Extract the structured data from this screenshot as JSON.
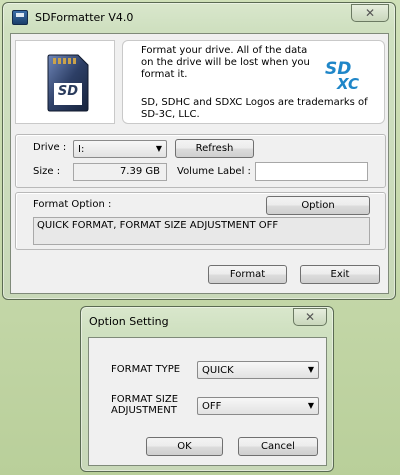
{
  "main_window": {
    "title": "SDFormatter V4.0",
    "close_glyph": "✕",
    "notice_line1": "Format your drive. All of the data",
    "notice_line2": "on the drive will be lost when you",
    "notice_line3": "format it.",
    "trademark_line1": "SD, SDHC and SDXC Logos are trademarks of",
    "trademark_line2": "SD-3C, LLC.",
    "logo_sd": "SD",
    "logo_xc": "XC",
    "card_label": "SD",
    "drive_label": "Drive :",
    "drive_value": "I:",
    "refresh_label": "Refresh",
    "size_label": "Size :",
    "size_value": "7.39  GB",
    "volume_label": "Volume Label :",
    "volume_value": "",
    "format_option_label": "Format Option :",
    "option_button": "Option",
    "format_option_text": "QUICK FORMAT, FORMAT SIZE ADJUSTMENT OFF",
    "format_button": "Format",
    "exit_button": "Exit"
  },
  "option_dialog": {
    "title": "Option Setting",
    "close_glyph": "✕",
    "format_type_label": "FORMAT TYPE",
    "format_type_value": "QUICK",
    "format_size_label_line1": "FORMAT SIZE",
    "format_size_label_line2": "ADJUSTMENT",
    "format_size_value": "OFF",
    "ok_button": "OK",
    "cancel_button": "Cancel"
  },
  "colors": {
    "sd_logo_blue": "#1f86c8",
    "card_dark": "#2a3b5c"
  },
  "icons": [
    "app-icon",
    "close-icon",
    "sd-card-icon",
    "sdxc-logo",
    "dropdown-arrow-icon"
  ]
}
